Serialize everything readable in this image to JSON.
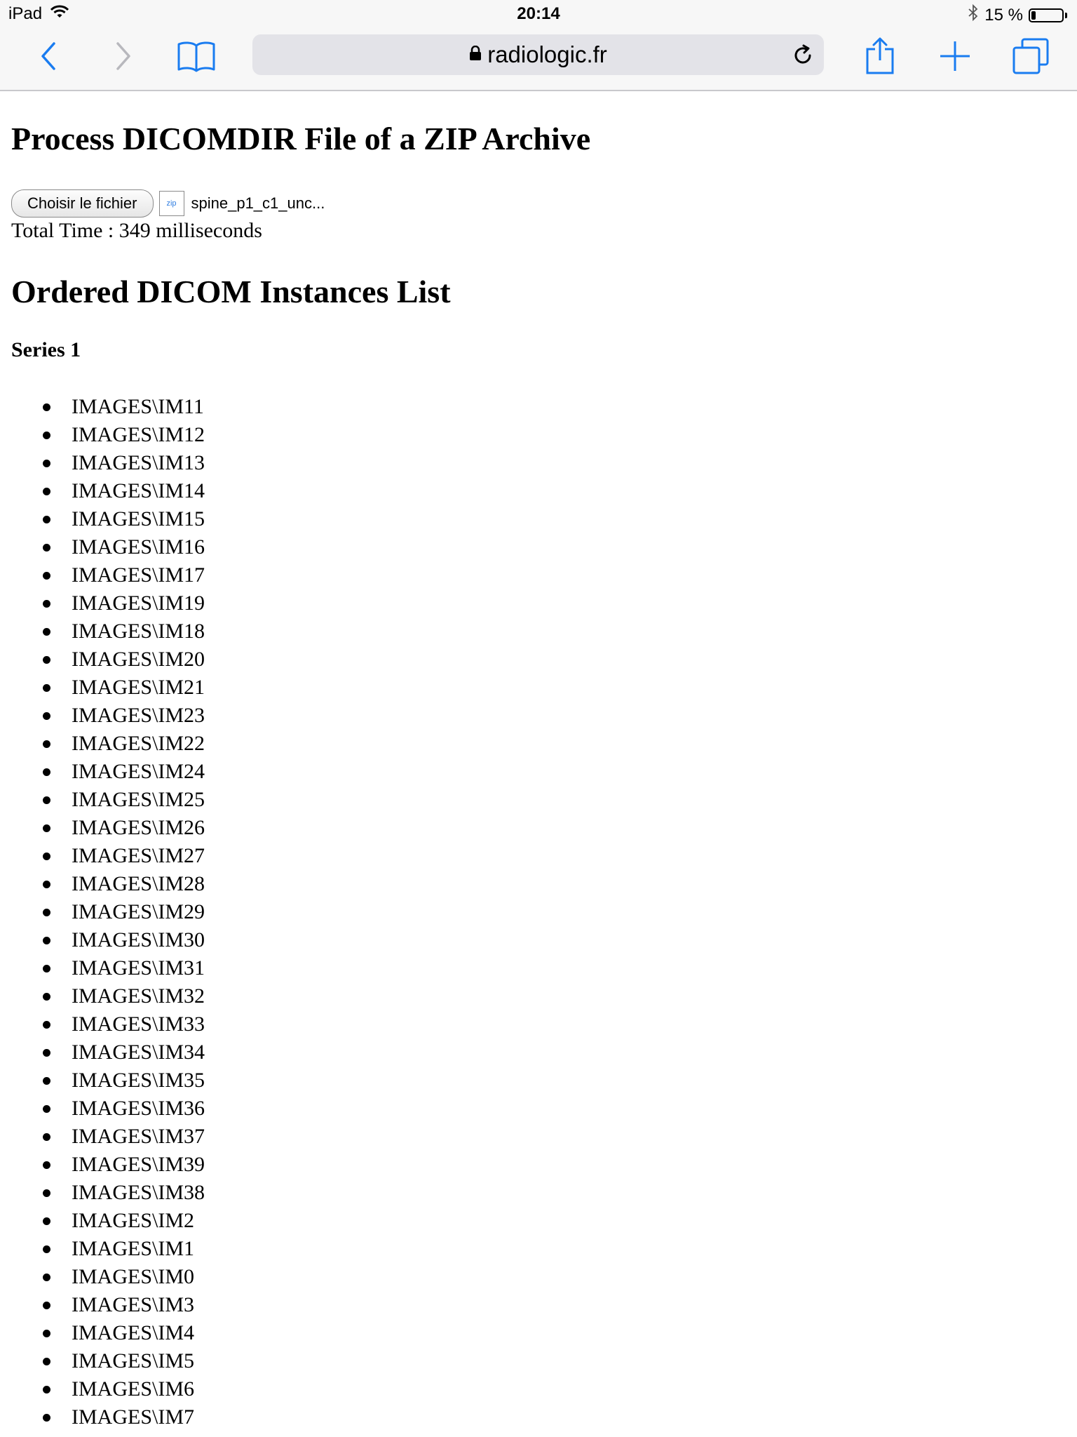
{
  "status_bar": {
    "device": "iPad",
    "time": "20:14",
    "battery": "15 %",
    "battery_level": 0.15
  },
  "browser": {
    "url": "radiologic.fr",
    "icons": [
      "back-icon",
      "forward-icon",
      "bookmarks-icon",
      "lock-icon",
      "reload-icon",
      "share-icon",
      "new-tab-icon",
      "tabs-icon"
    ],
    "accent_color": "#1a7cf0"
  },
  "page": {
    "title": "Process DICOMDIR File of a ZIP Archive",
    "choose_file_label": "Choisir le fichier",
    "file_icon_label": "zip",
    "file_name": "spine_p1_c1_unc...",
    "total_time": "Total Time : 349 milliseconds",
    "list_title": "Ordered DICOM Instances List",
    "series_title": "Series 1",
    "instances": [
      "IMAGES\\IM11",
      "IMAGES\\IM12",
      "IMAGES\\IM13",
      "IMAGES\\IM14",
      "IMAGES\\IM15",
      "IMAGES\\IM16",
      "IMAGES\\IM17",
      "IMAGES\\IM19",
      "IMAGES\\IM18",
      "IMAGES\\IM20",
      "IMAGES\\IM21",
      "IMAGES\\IM23",
      "IMAGES\\IM22",
      "IMAGES\\IM24",
      "IMAGES\\IM25",
      "IMAGES\\IM26",
      "IMAGES\\IM27",
      "IMAGES\\IM28",
      "IMAGES\\IM29",
      "IMAGES\\IM30",
      "IMAGES\\IM31",
      "IMAGES\\IM32",
      "IMAGES\\IM33",
      "IMAGES\\IM34",
      "IMAGES\\IM35",
      "IMAGES\\IM36",
      "IMAGES\\IM37",
      "IMAGES\\IM39",
      "IMAGES\\IM38",
      "IMAGES\\IM2",
      "IMAGES\\IM1",
      "IMAGES\\IM0",
      "IMAGES\\IM3",
      "IMAGES\\IM4",
      "IMAGES\\IM5",
      "IMAGES\\IM6",
      "IMAGES\\IM7"
    ]
  }
}
